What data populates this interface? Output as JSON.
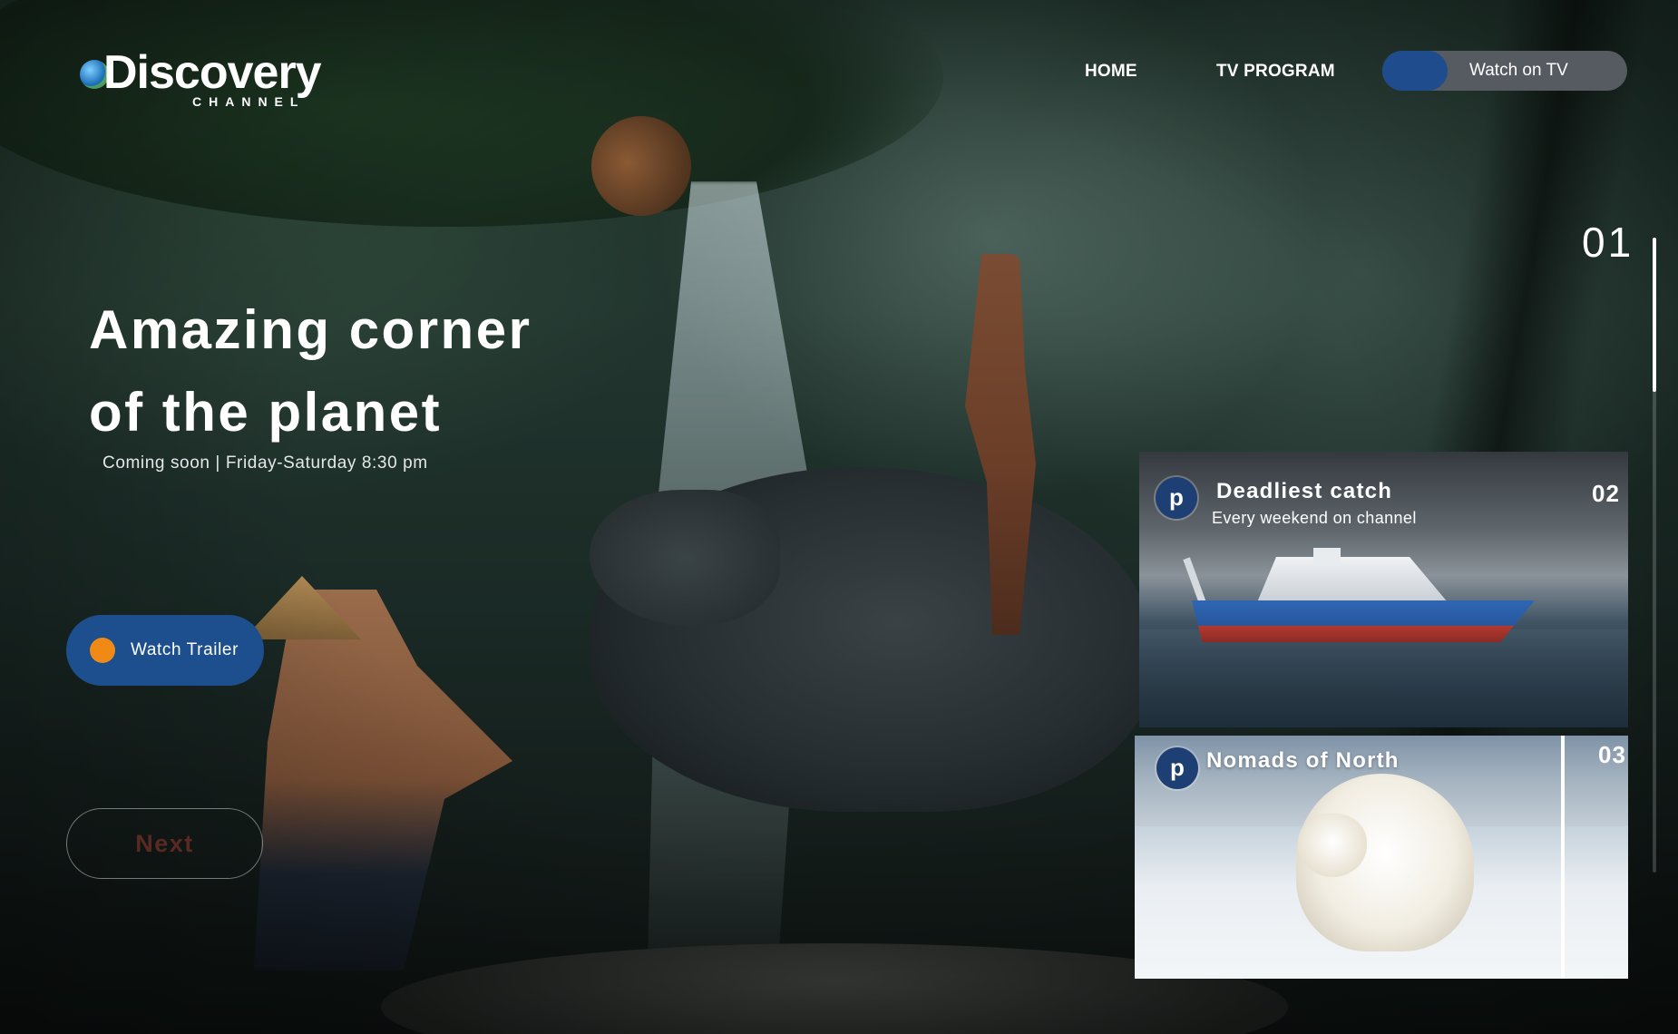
{
  "brand": {
    "name": "Discovery",
    "sub": "CHANNEL"
  },
  "nav": {
    "items": [
      {
        "label": "HOME"
      },
      {
        "label": "TV PROGRAM"
      }
    ],
    "watch_tv_label": "Watch on TV"
  },
  "hero": {
    "title_line1": "Amazing corner",
    "title_line2": "of the planet",
    "subtitle": "Coming soon | Friday-Saturday 8:30 pm",
    "trailer_label": "Watch Trailer",
    "next_label": "Next"
  },
  "slider": {
    "current": "01"
  },
  "cards": [
    {
      "badge": "p",
      "title": "Deadliest catch",
      "subtitle": "Every weekend on channel",
      "number": "02"
    },
    {
      "badge": "p",
      "title": "Nomads of North",
      "number": "03"
    }
  ],
  "colors": {
    "accent_blue": "#1d4f8f",
    "accent_orange": "#f08a17",
    "nav_text": "#ffffff"
  }
}
